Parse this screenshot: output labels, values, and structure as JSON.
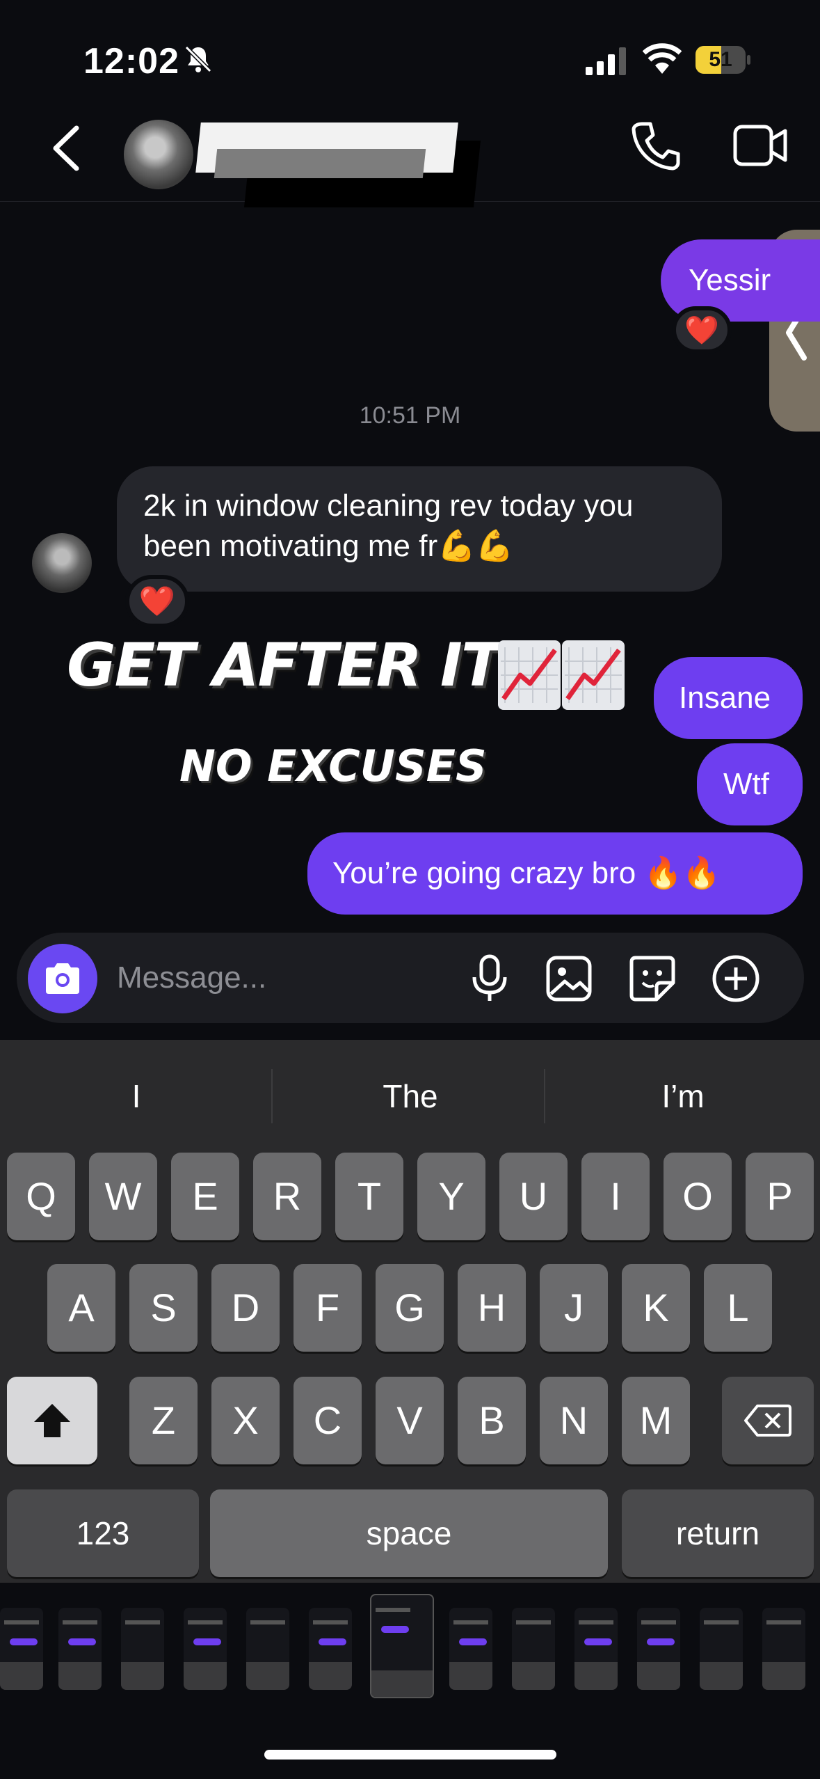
{
  "status_bar": {
    "time": "12:02",
    "battery_level": "51"
  },
  "conversation": {
    "messages": [
      {
        "id": "m1",
        "direction": "outgoing",
        "text": "Yessir",
        "reaction": "❤️"
      },
      {
        "id": "ts",
        "type": "timestamp",
        "text": "10:51 PM"
      },
      {
        "id": "m2",
        "direction": "incoming",
        "text_line1": "2k in window cleaning rev today you",
        "text_line2": "been motivating me fr💪💪",
        "reaction": "❤️"
      },
      {
        "id": "st",
        "type": "sticker",
        "line1": "GET AFTER IT",
        "line2": "NO EXCUSES"
      },
      {
        "id": "m3",
        "direction": "outgoing",
        "text": "Insane"
      },
      {
        "id": "m4",
        "direction": "outgoing",
        "text": "Wtf"
      },
      {
        "id": "m5",
        "direction": "outgoing",
        "text": "You’re going crazy bro 🔥🔥"
      }
    ]
  },
  "composer": {
    "placeholder": "Message..."
  },
  "keyboard": {
    "suggestions": [
      "I",
      "The",
      "I’m"
    ],
    "row1": [
      "Q",
      "W",
      "E",
      "R",
      "T",
      "Y",
      "U",
      "I",
      "O",
      "P"
    ],
    "row2": [
      "A",
      "S",
      "D",
      "F",
      "G",
      "H",
      "J",
      "K",
      "L"
    ],
    "row3": [
      "Z",
      "X",
      "C",
      "V",
      "B",
      "N",
      "M"
    ],
    "numbers_key": "123",
    "space_key": "space",
    "return_key": "return"
  },
  "colors": {
    "outgoing_bubble": "#6e3ef0",
    "incoming_bubble": "#25262c",
    "camera_button": "#6a48f2",
    "reaction_heart": "#e8252c"
  }
}
